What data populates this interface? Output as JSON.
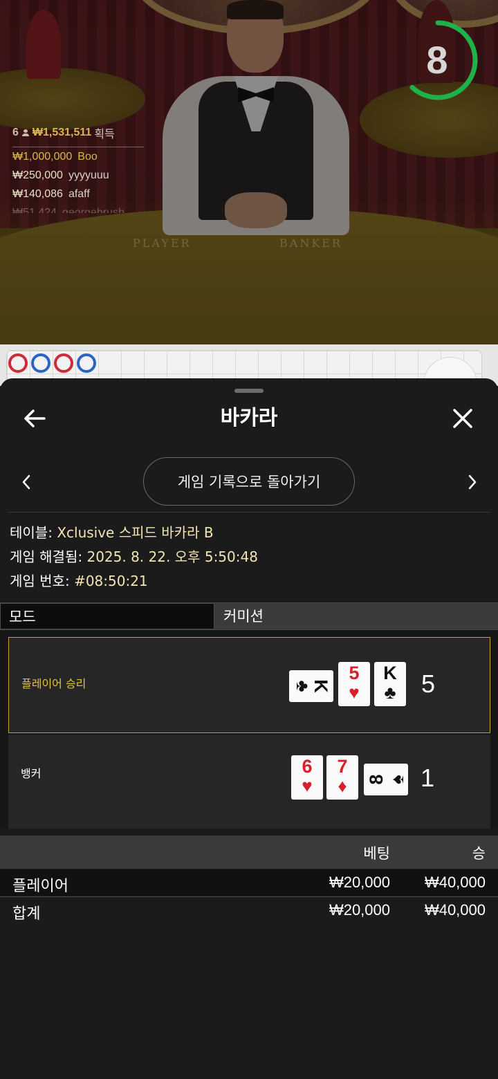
{
  "video": {
    "timer": "8",
    "timer_progress": 0.62,
    "felt_labels": [
      "PLAYER",
      "BANKER"
    ],
    "winners": {
      "count": "6",
      "total": "₩1,531,511",
      "label": "획득",
      "rows": [
        {
          "amount": "₩1,000,000",
          "name": "Boo"
        },
        {
          "amount": "₩250,000",
          "name": "yyyyuuu"
        },
        {
          "amount": "₩140,086",
          "name": "afaff"
        },
        {
          "amount": "₩51,424",
          "name": "georgebrush"
        }
      ]
    }
  },
  "roadmap": {
    "beads": [
      "red",
      "blue",
      "red",
      "blue"
    ]
  },
  "sheet": {
    "title": "바카라",
    "back_to_history": "게임 기록으로 돌아가기",
    "info": {
      "table_label": "테이블:",
      "table_value": "Xclusive 스피드 바카라 B",
      "resolved_label": "게임 해결됨:",
      "resolved_value": "2025. 8. 22. 오후 5:50:48",
      "number_label": "게임 번호:",
      "number_value": "#08:50:21"
    },
    "mode_label": "모드",
    "mode_value": "커미션",
    "player": {
      "label": "플레이어 승리",
      "score": "5",
      "cards": [
        {
          "rank": "K",
          "suit": "♣",
          "color": "black"
        },
        {
          "rank": "5",
          "suit": "♥",
          "color": "red"
        },
        {
          "rank": "K",
          "suit": "♣",
          "color": "black"
        }
      ]
    },
    "banker": {
      "label": "뱅커",
      "score": "1",
      "cards": [
        {
          "rank": "6",
          "suit": "♥",
          "color": "red"
        },
        {
          "rank": "7",
          "suit": "♦",
          "color": "red"
        },
        {
          "rank": "8",
          "suit": "♠",
          "color": "black"
        }
      ]
    },
    "bets": {
      "col_bet": "베팅",
      "col_win": "승",
      "rows": [
        {
          "name": "플레이어",
          "bet": "₩20,000",
          "win": "₩40,000"
        },
        {
          "name": "합계",
          "bet": "₩20,000",
          "win": "₩40,000"
        }
      ]
    }
  },
  "colors": {
    "accent_gold": "#c8a820",
    "timer_green": "#1fb14a",
    "card_red": "#d6202c"
  }
}
